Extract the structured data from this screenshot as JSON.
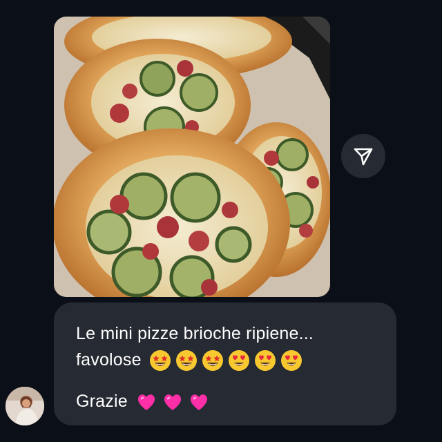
{
  "conversation": {
    "shared_post": {
      "icon": "pizza-photo"
    },
    "share_button": {
      "icon": "paper-plane-icon"
    },
    "message": {
      "line1": "Le mini pizze brioche ripiene...",
      "line2": "favolose",
      "line2_emojis": [
        "star-struck",
        "star-struck",
        "star-struck",
        "heart-eyes",
        "heart-eyes",
        "heart-eyes"
      ],
      "line3": "Grazie",
      "line3_emojis": [
        "pink-heart",
        "pink-heart",
        "pink-heart"
      ]
    },
    "sender_avatar": {
      "icon": "avatar"
    }
  },
  "colors": {
    "background": "#0b0f17",
    "bubble": "#262a32",
    "text": "#ffffff",
    "heart": "#ff2fa8"
  }
}
